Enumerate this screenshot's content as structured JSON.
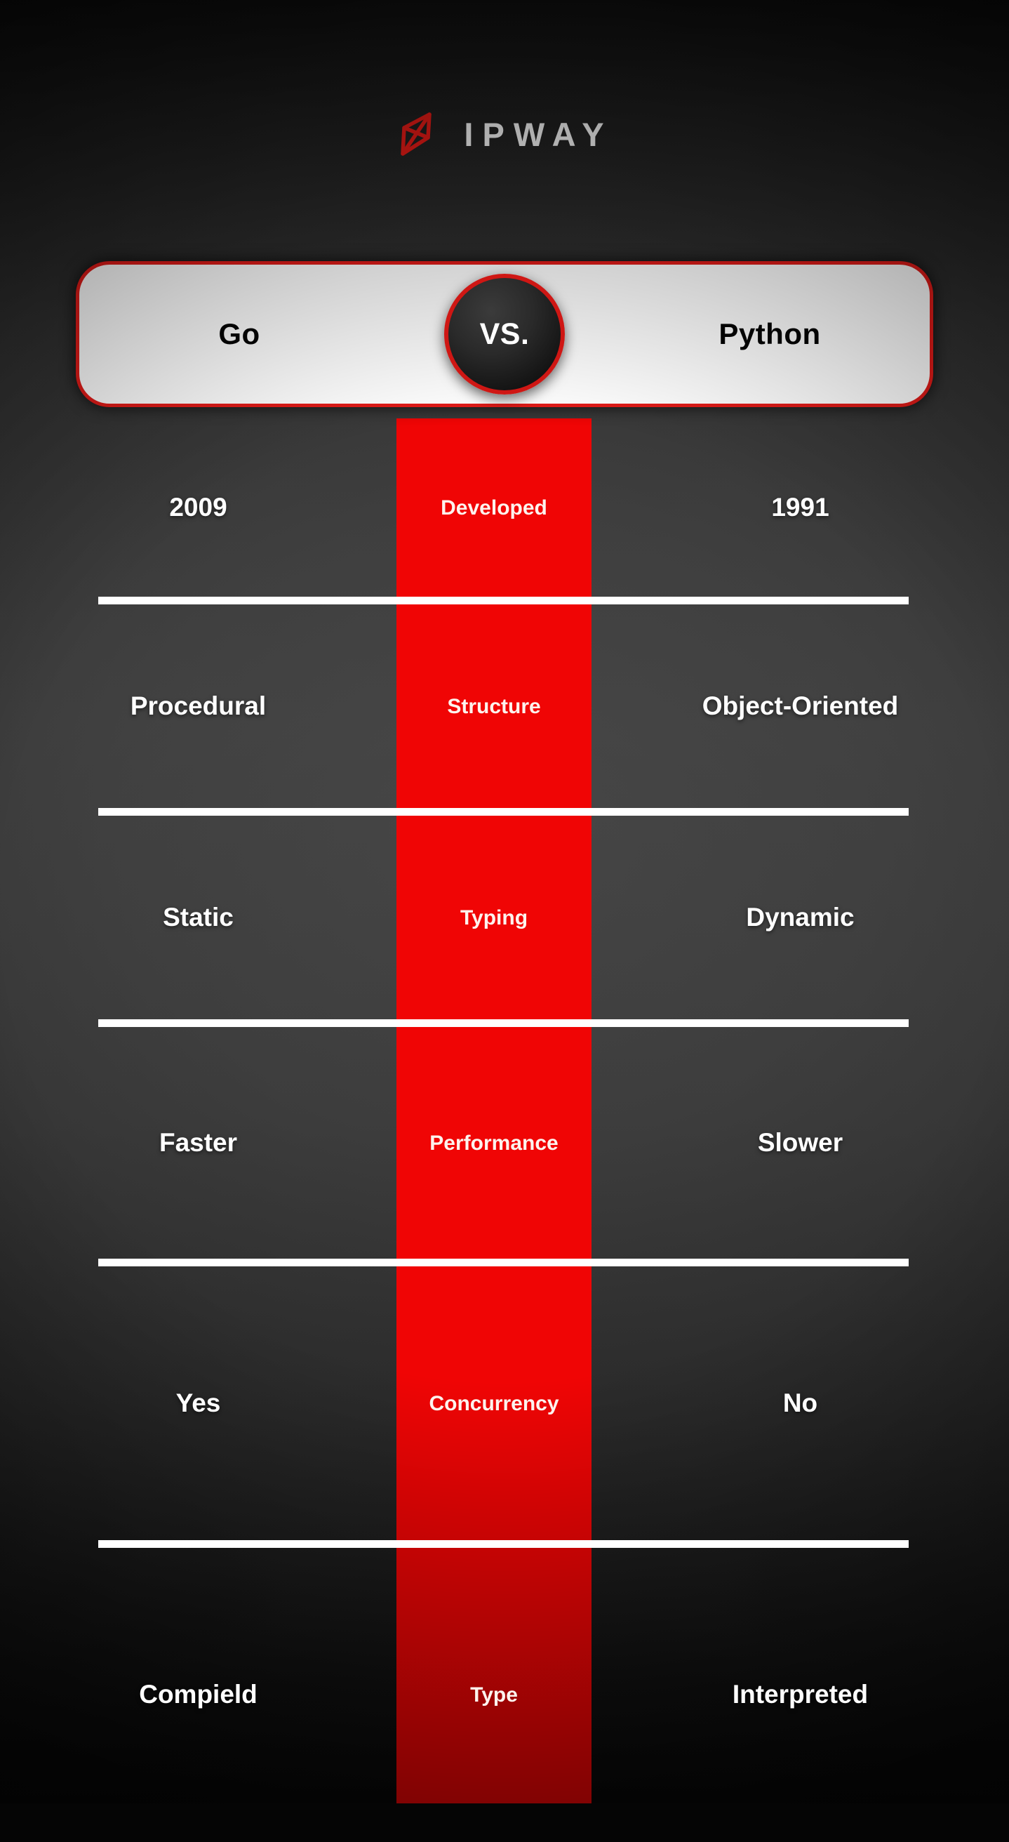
{
  "brand": {
    "logo_icon": "ipway-arrow-icon",
    "name": "IPWAY",
    "accent_color": "#e01b18"
  },
  "header": {
    "left_label": "Go",
    "right_label": "Python",
    "versus_label": "VS."
  },
  "comparison": {
    "rows": [
      {
        "left": "2009",
        "attribute": "Developed",
        "right": "1991"
      },
      {
        "left": "Procedural",
        "attribute": "Structure",
        "right": "Object-Oriented"
      },
      {
        "left": "Static",
        "attribute": "Typing",
        "right": "Dynamic"
      },
      {
        "left": "Faster",
        "attribute": "Performance",
        "right": "Slower"
      },
      {
        "left": "Yes",
        "attribute": "Concurrency",
        "right": "No"
      },
      {
        "left": "Compield",
        "attribute": "Type",
        "right": "Interpreted"
      }
    ]
  },
  "theme": {
    "background": "#1d1d1d",
    "band_color": "#f00505",
    "divider_color": "#ffffff",
    "text_color": "#ffffff",
    "panel_color": "#ffffff"
  }
}
